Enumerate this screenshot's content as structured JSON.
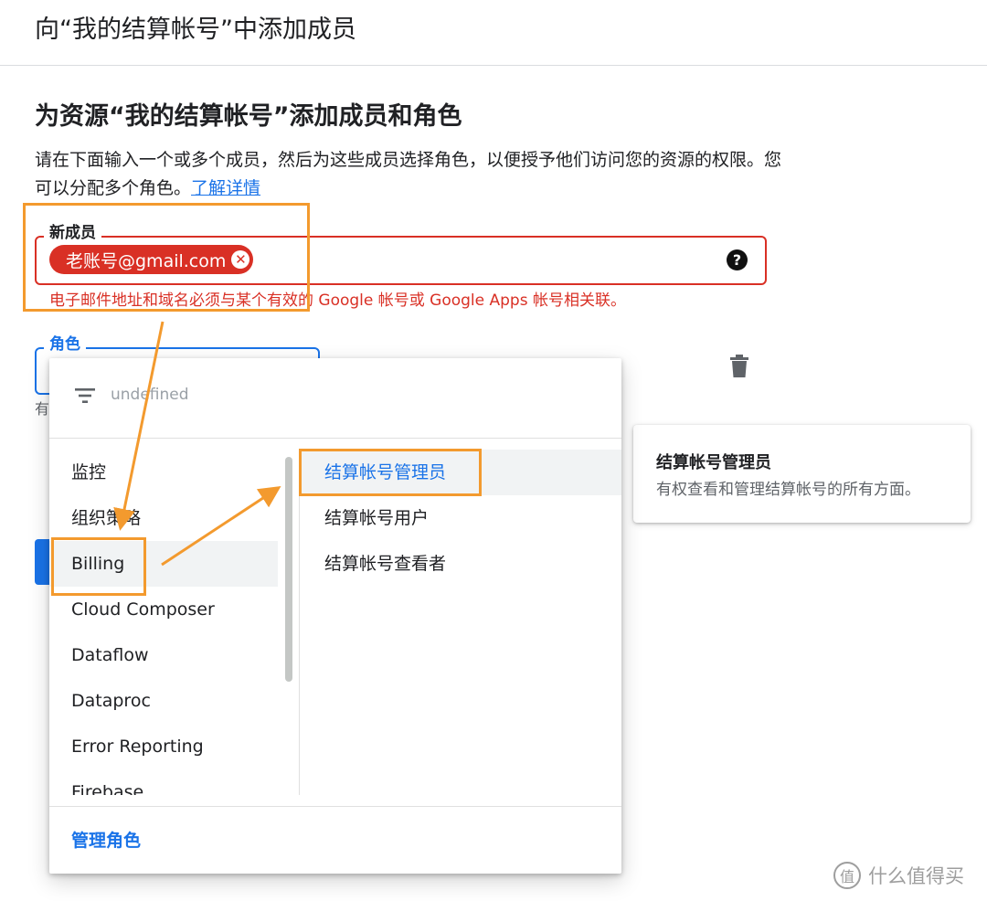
{
  "header": {
    "title": "向“我的结算帐号”中添加成员"
  },
  "section": {
    "title": "为资源“我的结算帐号”添加成员和角色",
    "description": "请在下面输入一个或多个成员，然后为这些成员选择角色，以便授予他们访问您的资源的权限。您可以分配多个角色。",
    "learn_more": "了解详情"
  },
  "member_field": {
    "label": "新成员",
    "chip": "老账号@gmail.com",
    "help_icon": "help-icon",
    "error": "电子邮件地址和域名必须与某个有效的 Google 帐号或 Google Apps 帐号相关联。"
  },
  "role_field": {
    "label": "角色",
    "hint": "有"
  },
  "dropdown": {
    "filter_placeholder": "undefined",
    "categories": [
      "监控",
      "组织策略",
      "Billing",
      "Cloud Composer",
      "Dataflow",
      "Dataproc",
      "Error Reporting",
      "Firebase"
    ],
    "selected_category": "Billing",
    "roles": [
      "结算帐号管理员",
      "结算帐号用户",
      "结算帐号查看者"
    ],
    "selected_role": "结算帐号管理员",
    "footer_link": "管理角色"
  },
  "info_card": {
    "title": "结算帐号管理员",
    "description": "有权查看和管理结算帐号的所有方面。"
  },
  "watermark": {
    "logo": "值",
    "text": "什么值得买"
  },
  "colors": {
    "accent": "#1a73e8",
    "error": "#d93025",
    "annotation": "#f39a2e"
  }
}
